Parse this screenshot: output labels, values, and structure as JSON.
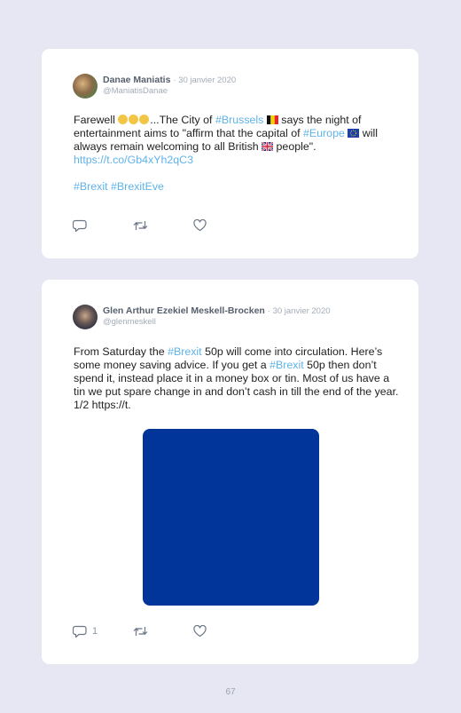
{
  "tweets": [
    {
      "author_name": "Danae Maniatis",
      "date": "· 30 janvier 2020",
      "handle": "@ManiatisDanae",
      "text": {
        "p1": "Farewell ",
        "p2": "...The City of ",
        "p3": "#Brussels",
        "p4": " says the night of entertainment aims to \"affirm that the capital of ",
        "p5": "#Europe",
        "p6": " will always remain welcoming to all British ",
        "p7": " people\".",
        "url": "https://t.co/Gb4xYh2qC3",
        "tag1": "#Brexit",
        "tag2": "#BrexitEve"
      },
      "reply_count": "",
      "icons": {
        "reply": "comment-icon",
        "retweet": "retweet-icon",
        "like": "heart-icon"
      }
    },
    {
      "author_name": "Glen Arthur Ezekiel Meskell-Brocken",
      "date": "· 30 janvier 2020",
      "handle": "@glenmeskell",
      "text": {
        "p1": "From Saturday the ",
        "p2": "#Brexit",
        "p3": " 50p will come into circulation. Here’s some money saving advice. If you get a ",
        "p4": "#Brexit",
        "p5": " 50p then don’t spend it, instead place it in a money box or tin. Most of us have a tin we put spare change in and don’t cash in till the end of the year. 1/2 https://t."
      },
      "reply_count": "1",
      "icons": {
        "reply": "comment-icon",
        "retweet": "retweet-icon",
        "like": "heart-icon"
      }
    }
  ],
  "colors": {
    "link": "#5fb3ea",
    "photo": "#02359a",
    "background": "#e6e7f3"
  },
  "page_number": "67"
}
